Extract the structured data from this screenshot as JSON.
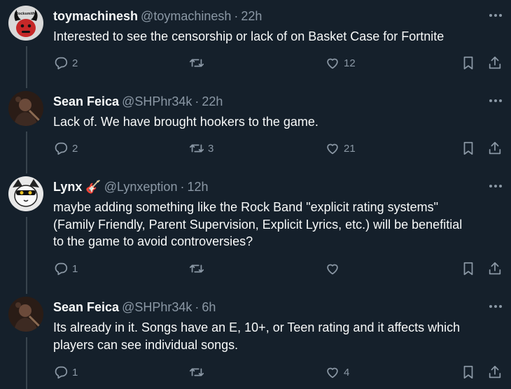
{
  "tweets": [
    {
      "name": "toymachinesh",
      "name_badge": "",
      "handle": "@toymachinesh",
      "time": "22h",
      "lines": [
        "Interested to see the censorship or lack of on Basket Case for Fortnite"
      ],
      "replies": "2",
      "retweets": "",
      "likes": "12",
      "avatar_text": "Rocksmith²"
    },
    {
      "name": "Sean Feica",
      "name_badge": "",
      "handle": "@SHPhr34k",
      "time": "22h",
      "lines": [
        "Lack of. We have brought hookers to the game."
      ],
      "replies": "2",
      "retweets": "3",
      "likes": "21",
      "avatar_text": ""
    },
    {
      "name": "Lynx",
      "name_badge": "🎸",
      "handle": "@Lynxeption",
      "time": "12h",
      "lines": [
        "maybe adding something like the Rock Band \"explicit rating systems\"",
        "(Family Friendly, Parent Supervision, Explicit Lyrics, etc.) will be benefitial",
        "to the game to avoid controversies?"
      ],
      "replies": "1",
      "retweets": "",
      "likes": "",
      "avatar_text": ""
    },
    {
      "name": "Sean Feica",
      "name_badge": "",
      "handle": "@SHPhr34k",
      "time": "6h",
      "lines": [
        "Its already in it. Songs have an E, 10+, or Teen rating and it affects which",
        "players can see individual songs."
      ],
      "replies": "1",
      "retweets": "",
      "likes": "4",
      "avatar_text": ""
    }
  ],
  "separator": "·",
  "colors": {
    "background": "#15202b",
    "text": "#f7f9f9",
    "muted": "#8b98a5",
    "thread_line": "#38444d"
  }
}
